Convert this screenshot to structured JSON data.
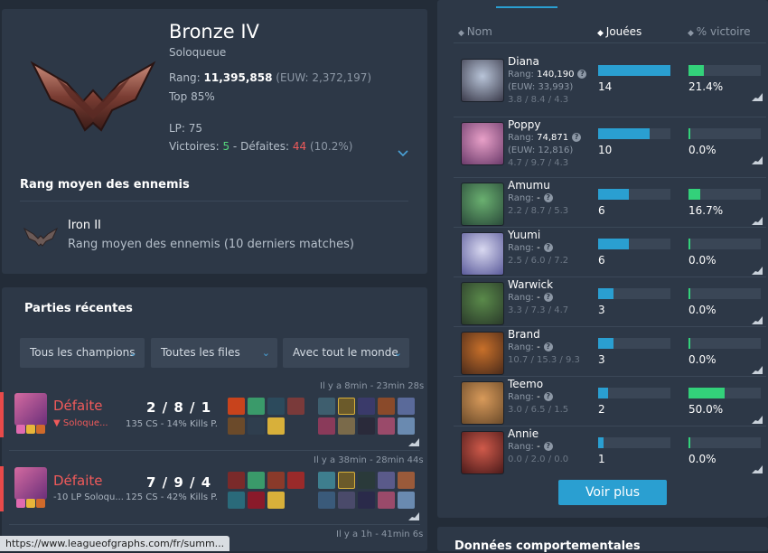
{
  "rank": {
    "tier": "Bronze IV",
    "queue": "Soloqueue",
    "rang_label": "Rang:",
    "rang_value": "11,395,858",
    "rang_euw": "(EUW: 2,372,197)",
    "top": "Top 85%",
    "lp": "LP: 75",
    "victoires_label": "Victoires:",
    "victoires": "5",
    "sep": "-",
    "defaites_label": "Défaites:",
    "defaites": "44",
    "ratio": "(10.2%)"
  },
  "enemy_rank": {
    "heading": "Rang moyen des ennemis",
    "tier": "Iron II",
    "description": "Rang moyen des ennemis (10 derniers matches)"
  },
  "recent": {
    "heading": "Parties récentes",
    "filters": [
      "Tous les champions",
      "Toutes les files",
      "Avec tout le monde"
    ],
    "matches": [
      {
        "result": "Défaite",
        "kda": "2 / 8 / 1",
        "line1": "▼ Soloque...",
        "stats": "135 CS - 14% Kills P.",
        "time": "Il y a 8min - 23min 28s"
      },
      {
        "result": "Défaite",
        "kda": "7 / 9 / 4",
        "line1": "-10 LP Soloqu...",
        "stats": "125 CS - 42% Kills P.",
        "time": "Il y a 38min - 28min 44s"
      },
      {
        "result": "",
        "kda": "",
        "line1": "",
        "stats": "",
        "time": "Il y a 1h - 41min 6s"
      }
    ]
  },
  "table": {
    "headers": {
      "name": "Nom",
      "played": "Jouées",
      "winrate": "% victoire"
    },
    "rows": [
      {
        "name": "Diana",
        "rank": "140,190",
        "euw": "(EUW: 33,993)",
        "kda": "3.8 / 8.4 / 4.3",
        "played": 14,
        "winrate": "21.4%",
        "played_pct": 100,
        "win_pct": 21.4
      },
      {
        "name": "Poppy",
        "rank": "74,871",
        "euw": "(EUW: 12,816)",
        "kda": "4.7 / 9.7 / 4.3",
        "played": 10,
        "winrate": "0.0%",
        "played_pct": 71,
        "win_pct": 0
      },
      {
        "name": "Amumu",
        "rank": "-",
        "euw": "",
        "kda": "2.2 / 8.7 / 5.3",
        "played": 6,
        "winrate": "16.7%",
        "played_pct": 43,
        "win_pct": 16.7
      },
      {
        "name": "Yuumi",
        "rank": "-",
        "euw": "",
        "kda": "2.5 / 6.0 / 7.2",
        "played": 6,
        "winrate": "0.0%",
        "played_pct": 43,
        "win_pct": 0
      },
      {
        "name": "Warwick",
        "rank": "-",
        "euw": "",
        "kda": "3.3 / 7.3 / 4.7",
        "played": 3,
        "winrate": "0.0%",
        "played_pct": 21,
        "win_pct": 0
      },
      {
        "name": "Brand",
        "rank": "-",
        "euw": "",
        "kda": "10.7 / 15.3 / 9.3",
        "played": 3,
        "winrate": "0.0%",
        "played_pct": 21,
        "win_pct": 0
      },
      {
        "name": "Teemo",
        "rank": "-",
        "euw": "",
        "kda": "3.0 / 6.5 / 1.5",
        "played": 2,
        "winrate": "50.0%",
        "played_pct": 14,
        "win_pct": 50
      },
      {
        "name": "Annie",
        "rank": "-",
        "euw": "",
        "kda": "0.0 / 2.0 / 0.0",
        "played": 1,
        "winrate": "0.0%",
        "played_pct": 7,
        "win_pct": 0
      }
    ],
    "rang_label": "Rang:",
    "more_button": "Voir plus"
  },
  "behavior_heading": "Données comportementales",
  "status_url": "https://www.leagueofgraphs.com/fr/summ...",
  "colors": {
    "accent": "#2a9fd1",
    "win": "#33d17a",
    "loss": "#ef5a5a",
    "panel": "#2d3847",
    "bg": "#232c38"
  }
}
